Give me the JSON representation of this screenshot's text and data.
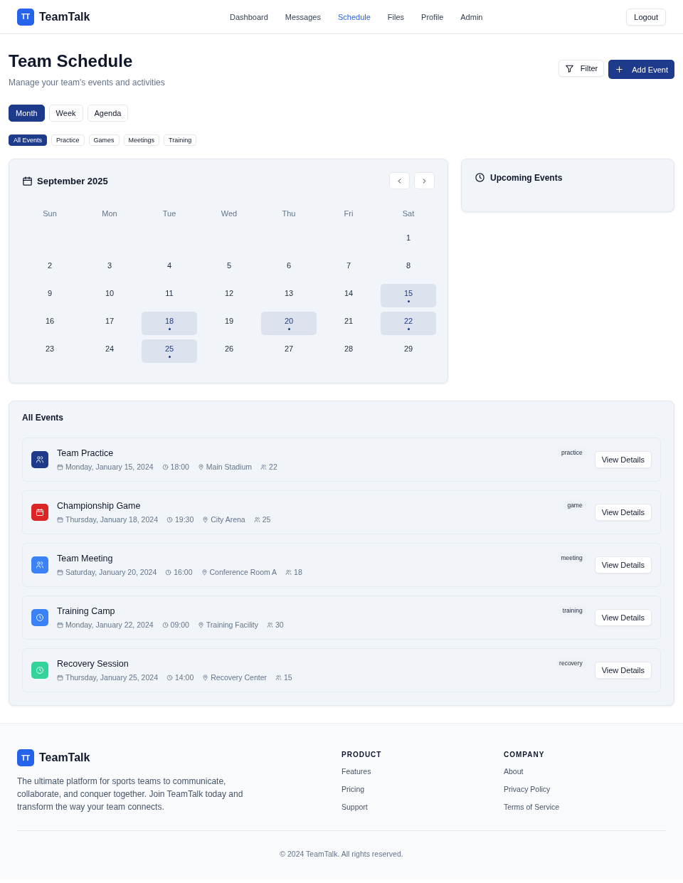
{
  "header": {
    "logo_mark": "TT",
    "brand": "TeamTalk",
    "nav": [
      {
        "label": "Dashboard",
        "selected": false
      },
      {
        "label": "Messages",
        "selected": false
      },
      {
        "label": "Schedule",
        "selected": true
      },
      {
        "label": "Files",
        "selected": false
      },
      {
        "label": "Profile",
        "selected": false
      },
      {
        "label": "Admin",
        "selected": false
      }
    ],
    "logout": "Logout"
  },
  "page": {
    "title": "Team Schedule",
    "subtitle": "Manage your team's events and activities",
    "filter_button": "Filter",
    "add_button": "Add Event"
  },
  "views": [
    {
      "label": "Month",
      "selected": true
    },
    {
      "label": "Week",
      "selected": false
    },
    {
      "label": "Agenda",
      "selected": false
    }
  ],
  "categories": [
    {
      "label": "All Events",
      "selected": true
    },
    {
      "label": "Practice",
      "selected": false
    },
    {
      "label": "Games",
      "selected": false
    },
    {
      "label": "Meetings",
      "selected": false
    },
    {
      "label": "Training",
      "selected": false
    }
  ],
  "calendar": {
    "month": "September 2025",
    "weekdays": [
      "Sun",
      "Mon",
      "Tue",
      "Wed",
      "Thu",
      "Fri",
      "Sat"
    ],
    "weeks": [
      {
        "kind": "end",
        "days": [
          {
            "day": "1",
            "has_event": false
          }
        ]
      },
      {
        "kind": "full",
        "days": [
          {
            "day": "2",
            "has_event": false
          },
          {
            "day": "3",
            "has_event": false
          },
          {
            "day": "4",
            "has_event": false
          },
          {
            "day": "5",
            "has_event": false
          },
          {
            "day": "6",
            "has_event": false
          },
          {
            "day": "7",
            "has_event": false
          },
          {
            "day": "8",
            "has_event": false
          }
        ]
      },
      {
        "kind": "full",
        "days": [
          {
            "day": "9",
            "has_event": false
          },
          {
            "day": "10",
            "has_event": false
          },
          {
            "day": "11",
            "has_event": false
          },
          {
            "day": "12",
            "has_event": false
          },
          {
            "day": "13",
            "has_event": false
          },
          {
            "day": "14",
            "has_event": false
          },
          {
            "day": "15",
            "has_event": true
          }
        ]
      },
      {
        "kind": "full",
        "days": [
          {
            "day": "16",
            "has_event": false
          },
          {
            "day": "17",
            "has_event": false
          },
          {
            "day": "18",
            "has_event": true
          },
          {
            "day": "19",
            "has_event": false
          },
          {
            "day": "20",
            "has_event": true
          },
          {
            "day": "21",
            "has_event": false
          },
          {
            "day": "22",
            "has_event": true
          }
        ]
      },
      {
        "kind": "full",
        "days": [
          {
            "day": "23",
            "has_event": false
          },
          {
            "day": "24",
            "has_event": false
          },
          {
            "day": "25",
            "has_event": true
          },
          {
            "day": "26",
            "has_event": false
          },
          {
            "day": "27",
            "has_event": false
          },
          {
            "day": "28",
            "has_event": false
          },
          {
            "day": "29",
            "has_event": false
          }
        ]
      }
    ]
  },
  "upcoming": {
    "title": "Upcoming Events"
  },
  "events": {
    "title": "All Events",
    "items": [
      {
        "title": "Team Practice",
        "kind": "people",
        "color": "#1e3a8a",
        "date": "Monday, January 15, 2024",
        "time": "18:00",
        "place": "Main Stadium",
        "attendees": "22",
        "tag": "practice",
        "button": "View Details"
      },
      {
        "title": "Championship Game",
        "kind": "calendar",
        "color": "#dc2626",
        "date": "Thursday, January 18, 2024",
        "time": "19:30",
        "place": "City Arena",
        "attendees": "25",
        "tag": "game",
        "button": "View Details"
      },
      {
        "title": "Team Meeting",
        "kind": "people",
        "color": "#3b82f6",
        "date": "Saturday, January 20, 2024",
        "time": "16:00",
        "place": "Conference Room A",
        "attendees": "18",
        "tag": "meeting",
        "button": "View Details"
      },
      {
        "title": "Training Camp",
        "kind": "clock",
        "color": "#3b82f6",
        "date": "Monday, January 22, 2024",
        "time": "09:00",
        "place": "Training Facility",
        "attendees": "30",
        "tag": "training",
        "button": "View Details"
      },
      {
        "title": "Recovery Session",
        "kind": "clock",
        "color": "#34d399",
        "date": "Thursday, January 25, 2024",
        "time": "14:00",
        "place": "Recovery Center",
        "attendees": "15",
        "tag": "recovery",
        "button": "View Details"
      }
    ]
  },
  "footer": {
    "logo_mark": "TT",
    "brand": "TeamTalk",
    "blurb": "The ultimate platform for sports teams to communicate, collaborate, and conquer together. Join TeamTalk today and transform the way your team connects.",
    "columns": [
      {
        "heading": "PRODUCT",
        "links": [
          "Features",
          "Pricing",
          "Support"
        ]
      },
      {
        "heading": "COMPANY",
        "links": [
          "About",
          "Privacy Policy",
          "Terms of Service"
        ]
      }
    ],
    "copyright": "© 2024 TeamTalk. All rights reserved."
  }
}
